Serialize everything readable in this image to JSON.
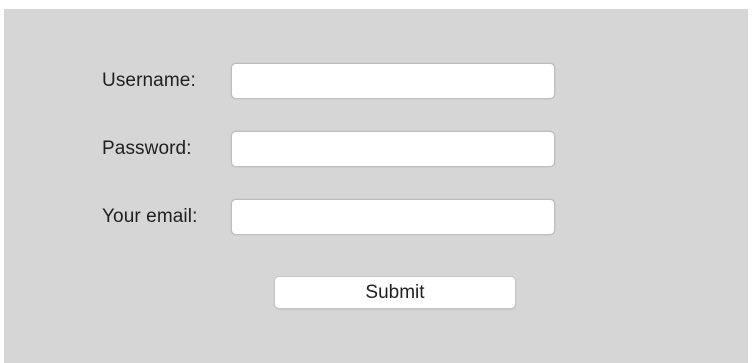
{
  "form": {
    "username_label": "Username:",
    "username_value": "",
    "password_label": "Password:",
    "password_value": "",
    "email_label": "Your email:",
    "email_value": "",
    "submit_label": "Submit"
  },
  "colors": {
    "panel_background": "#d6d6d6",
    "field_background": "#ffffff",
    "text": "#1f1f1f"
  }
}
